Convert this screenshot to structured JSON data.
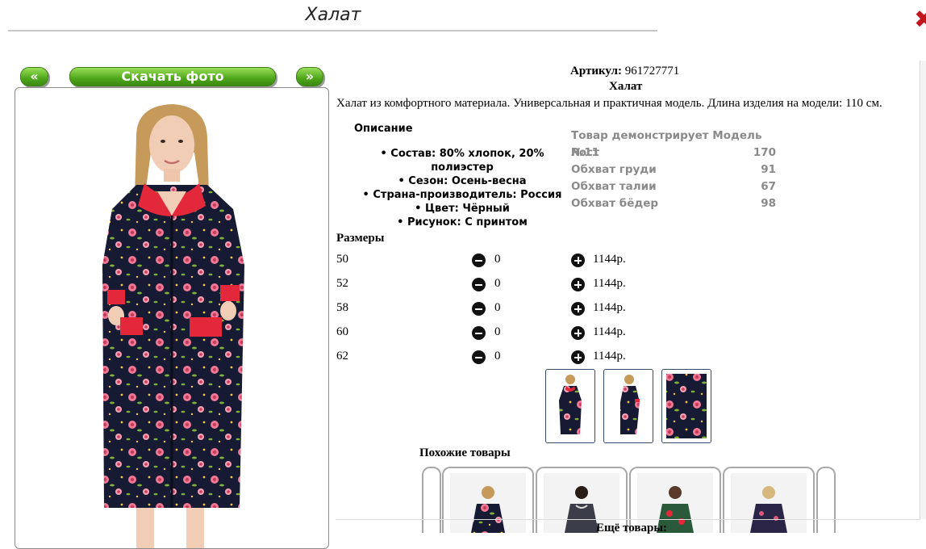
{
  "header": {
    "title": "Халат",
    "close_icon": "close-x-icon",
    "accent": "#c0161b"
  },
  "gallery": {
    "prev_label": "«",
    "next_label": "»",
    "download_label": "Скачать фото"
  },
  "product": {
    "article_label": "Артикул:",
    "article_value": "961727771",
    "name": "Халат",
    "description": "Халат из комфортного материала. Универсальная и практичная модель. Длина изделия на модели: 110 см."
  },
  "description_block": {
    "heading": "Описание",
    "items": [
      "• Состав: 80% хлопок, 20% полиэстер",
      "• Сезон: Осень-весна",
      "• Страна-производитель: Россия",
      "• Цвет: Чёрный",
      "• Рисунок: С принтом"
    ]
  },
  "model_info": {
    "heading": "Товар демонстрирует Модель №11",
    "rows": [
      {
        "label": "Рост",
        "value": "170"
      },
      {
        "label": "Обхват груди",
        "value": "91"
      },
      {
        "label": "Обхват талии",
        "value": "67"
      },
      {
        "label": "Обхват бёдер",
        "value": "98"
      }
    ]
  },
  "sizes": {
    "heading": "Размеры",
    "rows": [
      {
        "size": "50",
        "qty": "0",
        "price": "1144р."
      },
      {
        "size": "52",
        "qty": "0",
        "price": "1144р."
      },
      {
        "size": "58",
        "qty": "0",
        "price": "1144р."
      },
      {
        "size": "60",
        "qty": "0",
        "price": "1144р."
      },
      {
        "size": "62",
        "qty": "0",
        "price": "1144р."
      }
    ]
  },
  "similar": {
    "heading": "Похожие товары",
    "more_label": "Ещё товары:"
  },
  "colors": {
    "button_green": "#4ea61a",
    "robe_dark": "#161a33",
    "robe_red": "#e3283b",
    "rose_pink": "#f07a96"
  }
}
